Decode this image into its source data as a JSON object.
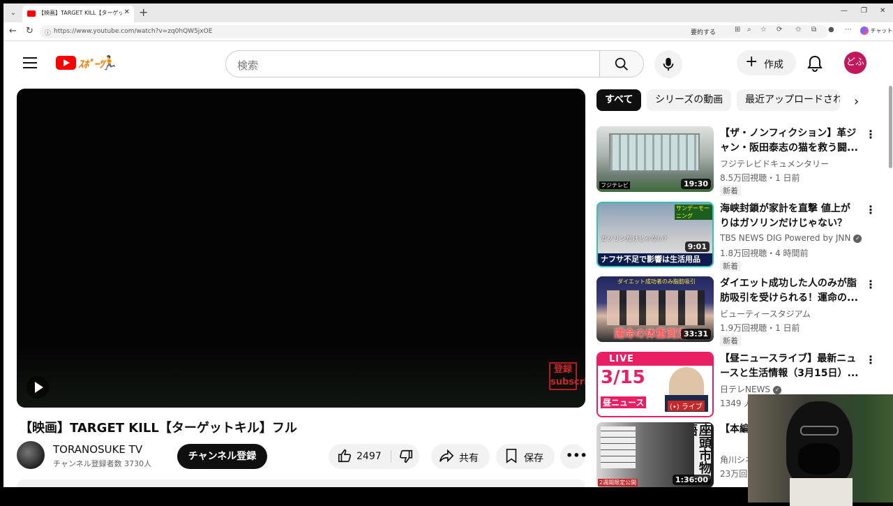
{
  "browser": {
    "tab_title": "【映画】TARGET KILL【ターゲットキル】フ",
    "url": "https://www.youtube.com/watch?v=zq0hQW5jxOE",
    "summarize_label": "要約する",
    "chat_label": "チャット"
  },
  "header": {
    "search_placeholder": "検索",
    "create_label": "作成",
    "avatar_text": "どふ",
    "logo_doodle": "ｽﾎﾟｰﾂ"
  },
  "video": {
    "title": "【映画】TARGET KILL【ターゲットキル】フル",
    "watermark": "登録 subscribe",
    "channel_name": "TORANOSUKE TV",
    "channel_subs": "チャンネル登録者数 3730人",
    "subscribe_label": "チャンネル登録",
    "like_count": "2497",
    "share_label": "共有",
    "save_label": "保存"
  },
  "chips": [
    "すべて",
    "シリーズの動画",
    "最近アップロードされた"
  ],
  "recommendations": [
    {
      "title": "【ザ・ノンフィクション】革ジャン・阪田泰志の猫を救う闘...",
      "channel": "フジテレビドキュメンタリー",
      "verified": false,
      "meta": "8.5万回視聴・1 日前",
      "badge": "新着",
      "duration": "19:30",
      "thumb_colors": [
        "#c9ccc8",
        "#7d8a86",
        "#3f6b3b"
      ]
    },
    {
      "title": "海峡封鎖が家計を直撃 値上がりはガソリンだけじゃない？ 石...",
      "channel": "TBS NEWS DIG Powered by JNN",
      "verified": true,
      "meta": "1.8万回視聴・4 時間前",
      "badge": "新着",
      "duration": "9:01",
      "thumb_colors": [
        "#8fa3b8",
        "#d9d9d9",
        "#1a237e"
      ]
    },
    {
      "title": "ダイエット成功した人のみが脂肪吸引を受けられる！運命の...",
      "channel": "ビューティースタジアム",
      "verified": false,
      "meta": "1.9万回視聴・1 日前",
      "badge": "新着",
      "duration": "33:31",
      "thumb_colors": [
        "#2b2f6b",
        "#e6c9b8",
        "#c2185b"
      ]
    },
    {
      "title": "【昼ニュースライブ】最新ニュースと生活情報（3月15日）...",
      "channel": "日テレNEWS",
      "verified": true,
      "meta": "1349 人",
      "badge": "",
      "duration": "",
      "thumb_colors": [
        "#e91e63",
        "#ffffff",
        "#2e7d32"
      ]
    },
    {
      "title": "【本編】限定配",
      "channel": "角川シネ",
      "verified": false,
      "meta": "23万回",
      "badge": "",
      "duration": "1:36:00",
      "thumb_colors": [
        "#e0e0e0",
        "#1b1b1b",
        "#d32f2f"
      ]
    }
  ],
  "thumb_text": {
    "r1_caption": "フジテレビ",
    "r2_caption": "ナフサ不足で影響は生活用品",
    "r2_top": "ガソリンだけじゃない?",
    "r3_caption": "運命の体重測定",
    "r3_top": "ダイエット成功者のみ脂肪吸引",
    "r4_date": "3/15",
    "r4_live": "LIVE",
    "r4_news": "昼ニュース",
    "r4_live_badge": "(•) ライブ",
    "r5_side": "座頭市物語",
    "r5_note": "2週間限定公開"
  }
}
